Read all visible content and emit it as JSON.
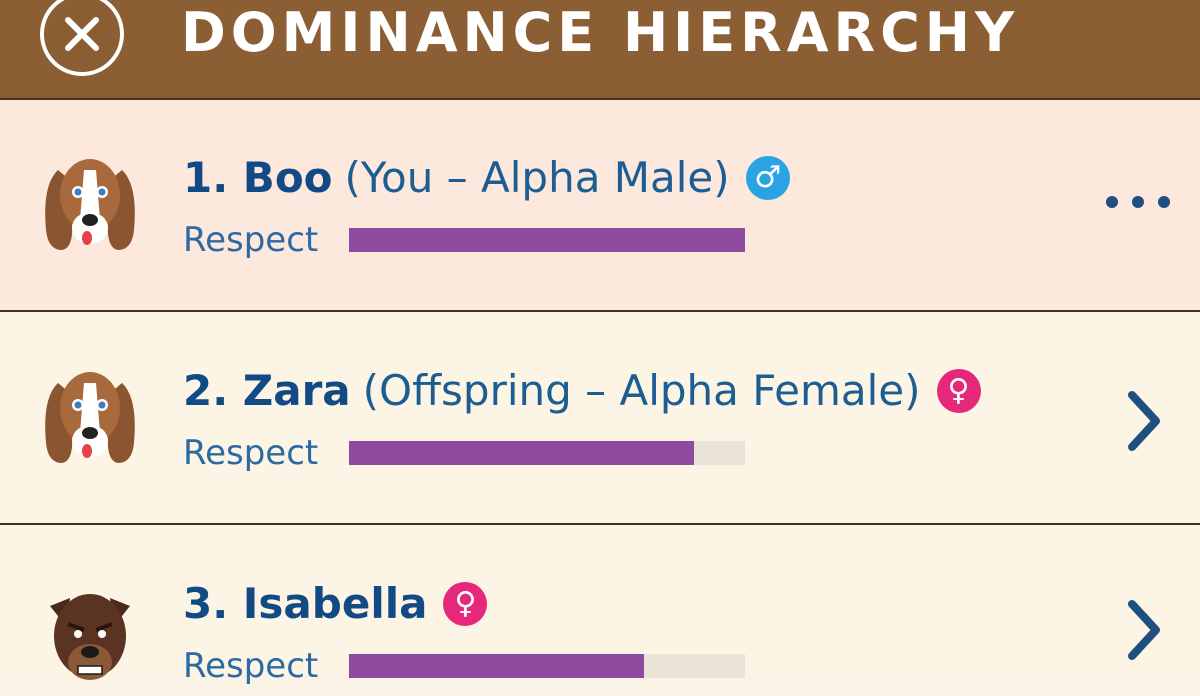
{
  "header": {
    "title": "DOMINANCE HIERARCHY",
    "close_icon": "close-icon"
  },
  "rows": [
    {
      "rank_name": "1. Boo",
      "role": "(You – Alpha Male)",
      "gender_symbol": "♂",
      "gender": "male",
      "respect_label": "Respect",
      "respect_fraction": 1.0,
      "action": "more-options"
    },
    {
      "rank_name": "2. Zara",
      "role": "(Offspring – Alpha Female)",
      "gender_symbol": "♀",
      "gender": "female",
      "respect_label": "Respect",
      "respect_fraction": 0.87,
      "action": "open-details"
    },
    {
      "rank_name": "3. Isabella",
      "role": "",
      "gender_symbol": "♀",
      "gender": "female",
      "respect_label": "Respect",
      "respect_fraction": 0.745,
      "action": "open-details"
    }
  ],
  "colors": {
    "header": "#8b5e34",
    "highlight_row": "#fde8de",
    "row": "#fcf5e6",
    "respect_bar": "#8e4a9e",
    "male": "#2aa3e4",
    "female": "#e5287a"
  }
}
